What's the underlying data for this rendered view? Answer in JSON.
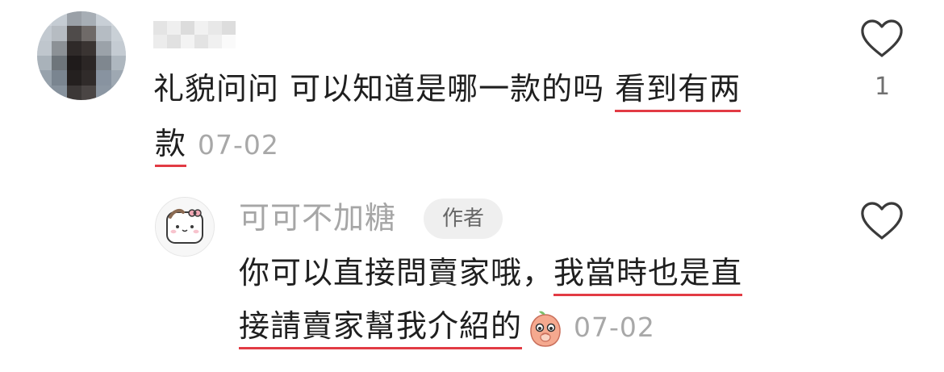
{
  "comment": {
    "text_part1": "礼貌问问 可以知道是哪一款的吗 ",
    "text_highlight1": "看到有两",
    "text_highlight2": "款",
    "date": "07-02",
    "like_count": "1"
  },
  "reply": {
    "author_name": "可可不加糖",
    "author_badge": "作者",
    "text_part1": "你可以直接問賣家哦，",
    "text_highlight1": "我當時也是直",
    "text_highlight2": "接請賣家幫我介紹的",
    "date": "07-02"
  },
  "colors": {
    "highlight_underline": "#e23b44",
    "muted_text": "#a8a8a8"
  },
  "icons": {
    "like": "heart-outline-icon",
    "emoji": "peach-emoji-icon"
  }
}
